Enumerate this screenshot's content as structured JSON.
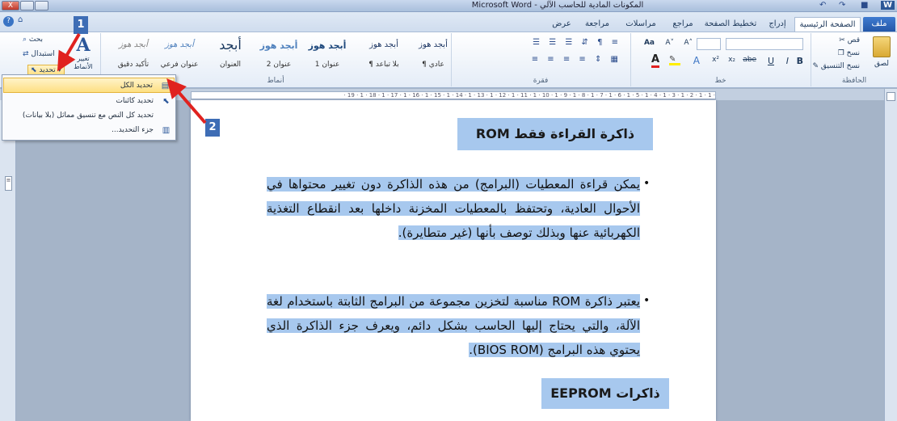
{
  "window": {
    "title": "المكونات المادية للحاسب الآلي - Microsoft Word",
    "close_glyph": "X"
  },
  "quick_access": {
    "undo": "↶",
    "redo": "↷",
    "save": "■",
    "word_icon": "W"
  },
  "ribbon_tabs": [
    {
      "label": "ملف"
    },
    {
      "label": "الصفحة الرئيسية"
    },
    {
      "label": "إدراج"
    },
    {
      "label": "تخطيط الصفحة"
    },
    {
      "label": "مراجع"
    },
    {
      "label": "مراسلات"
    },
    {
      "label": "مراجعة"
    },
    {
      "label": "عرض"
    }
  ],
  "ribbon": {
    "clipboard": {
      "label": "الحافظة",
      "paste": "لصق",
      "cut": "قص",
      "copy": "نسخ",
      "format_painter": "نسخ التنسيق"
    },
    "font": {
      "label": "خط",
      "size_grow": "A˄",
      "size_shrink": "A˅",
      "aa": "Aa",
      "bold": "B",
      "italic": "I",
      "underline": "U",
      "strike": "abe",
      "subscript": "x₂",
      "superscript": "x²"
    },
    "paragraph": {
      "label": "فقرة"
    },
    "styles": {
      "label": "أنماط",
      "change_styles": "تغيير الأنماط",
      "items": [
        {
          "sample": "أبجد هوز",
          "name": "¶ عادي"
        },
        {
          "sample": "أبجد هوز",
          "name": "¶ بلا تباعد"
        },
        {
          "sample": "أبجد هوز",
          "name": "عنوان 1"
        },
        {
          "sample": "أبجد هوز",
          "name": "عنوان 2"
        },
        {
          "sample": "أبجد",
          "name": "العنوان"
        },
        {
          "sample": "أبجد هوز",
          "name": "عنوان فرعي"
        },
        {
          "sample": "أبجد هوز",
          "name": "تأكيد دقيق"
        }
      ]
    },
    "editing": {
      "find": "بحث",
      "replace": "استبدال",
      "select": "تحديد"
    }
  },
  "select_menu": {
    "items": [
      {
        "label": "تحديد الكل",
        "icon": "select-all-icon"
      },
      {
        "label": "تحديد كائنات",
        "icon": "select-objects-icon"
      },
      {
        "label": "تحديد كل النص مع تنسيق مماثل (بلا بيانات)",
        "icon": "select-similar-icon"
      },
      {
        "label": "جزء التحديد...",
        "icon": "selection-pane-icon"
      }
    ]
  },
  "callouts": {
    "one": "1",
    "two": "2"
  },
  "ruler": {
    "text": "· 1 · 1 · 2 · 1 · 3 · 1 · 4 · 1 · 5 · 1 · 6 · 1 · 7 · 1 · 8 · 1 · 9 · 1 · 10 · 1 · 11 · 1 · 12 · 1 · 13 · 1 · 14 · 1 · 15 · 1 · 16 · 1 · 17 · 1 · 18 · 1 · 19 ·"
  },
  "document": {
    "heading1": "ذاكرة القراءة فقط ROM",
    "bullet1": "يمكن قراءة المعطيات (البرامج) من هذه الذاكرة دون تغيير محتواها في الأحوال العادية، وتحتفظ بالمعطيات المخزنة داخلها بعد انقطاع التغذية الكهربائية عنها وبذلك توصف بأنها (غير متطايرة).",
    "bullet2": "يعتبر ذاكرة ROM مناسبة لتخزين مجموعة من البرامج الثابتة باستخدام لغة الآلة، والتي يحتاج إليها الحاسب بشكل دائم، ويعرف جزء الذاكرة الذي يحتوي هذه البرامج (BIOS ROM).",
    "heading2": "ذاكرات EEPROM"
  },
  "colors": {
    "selection_highlight": "#a7c8ee",
    "callout_blue": "#3e6db5",
    "arrow_red": "#e0221f",
    "file_tab": "#2457a8"
  }
}
